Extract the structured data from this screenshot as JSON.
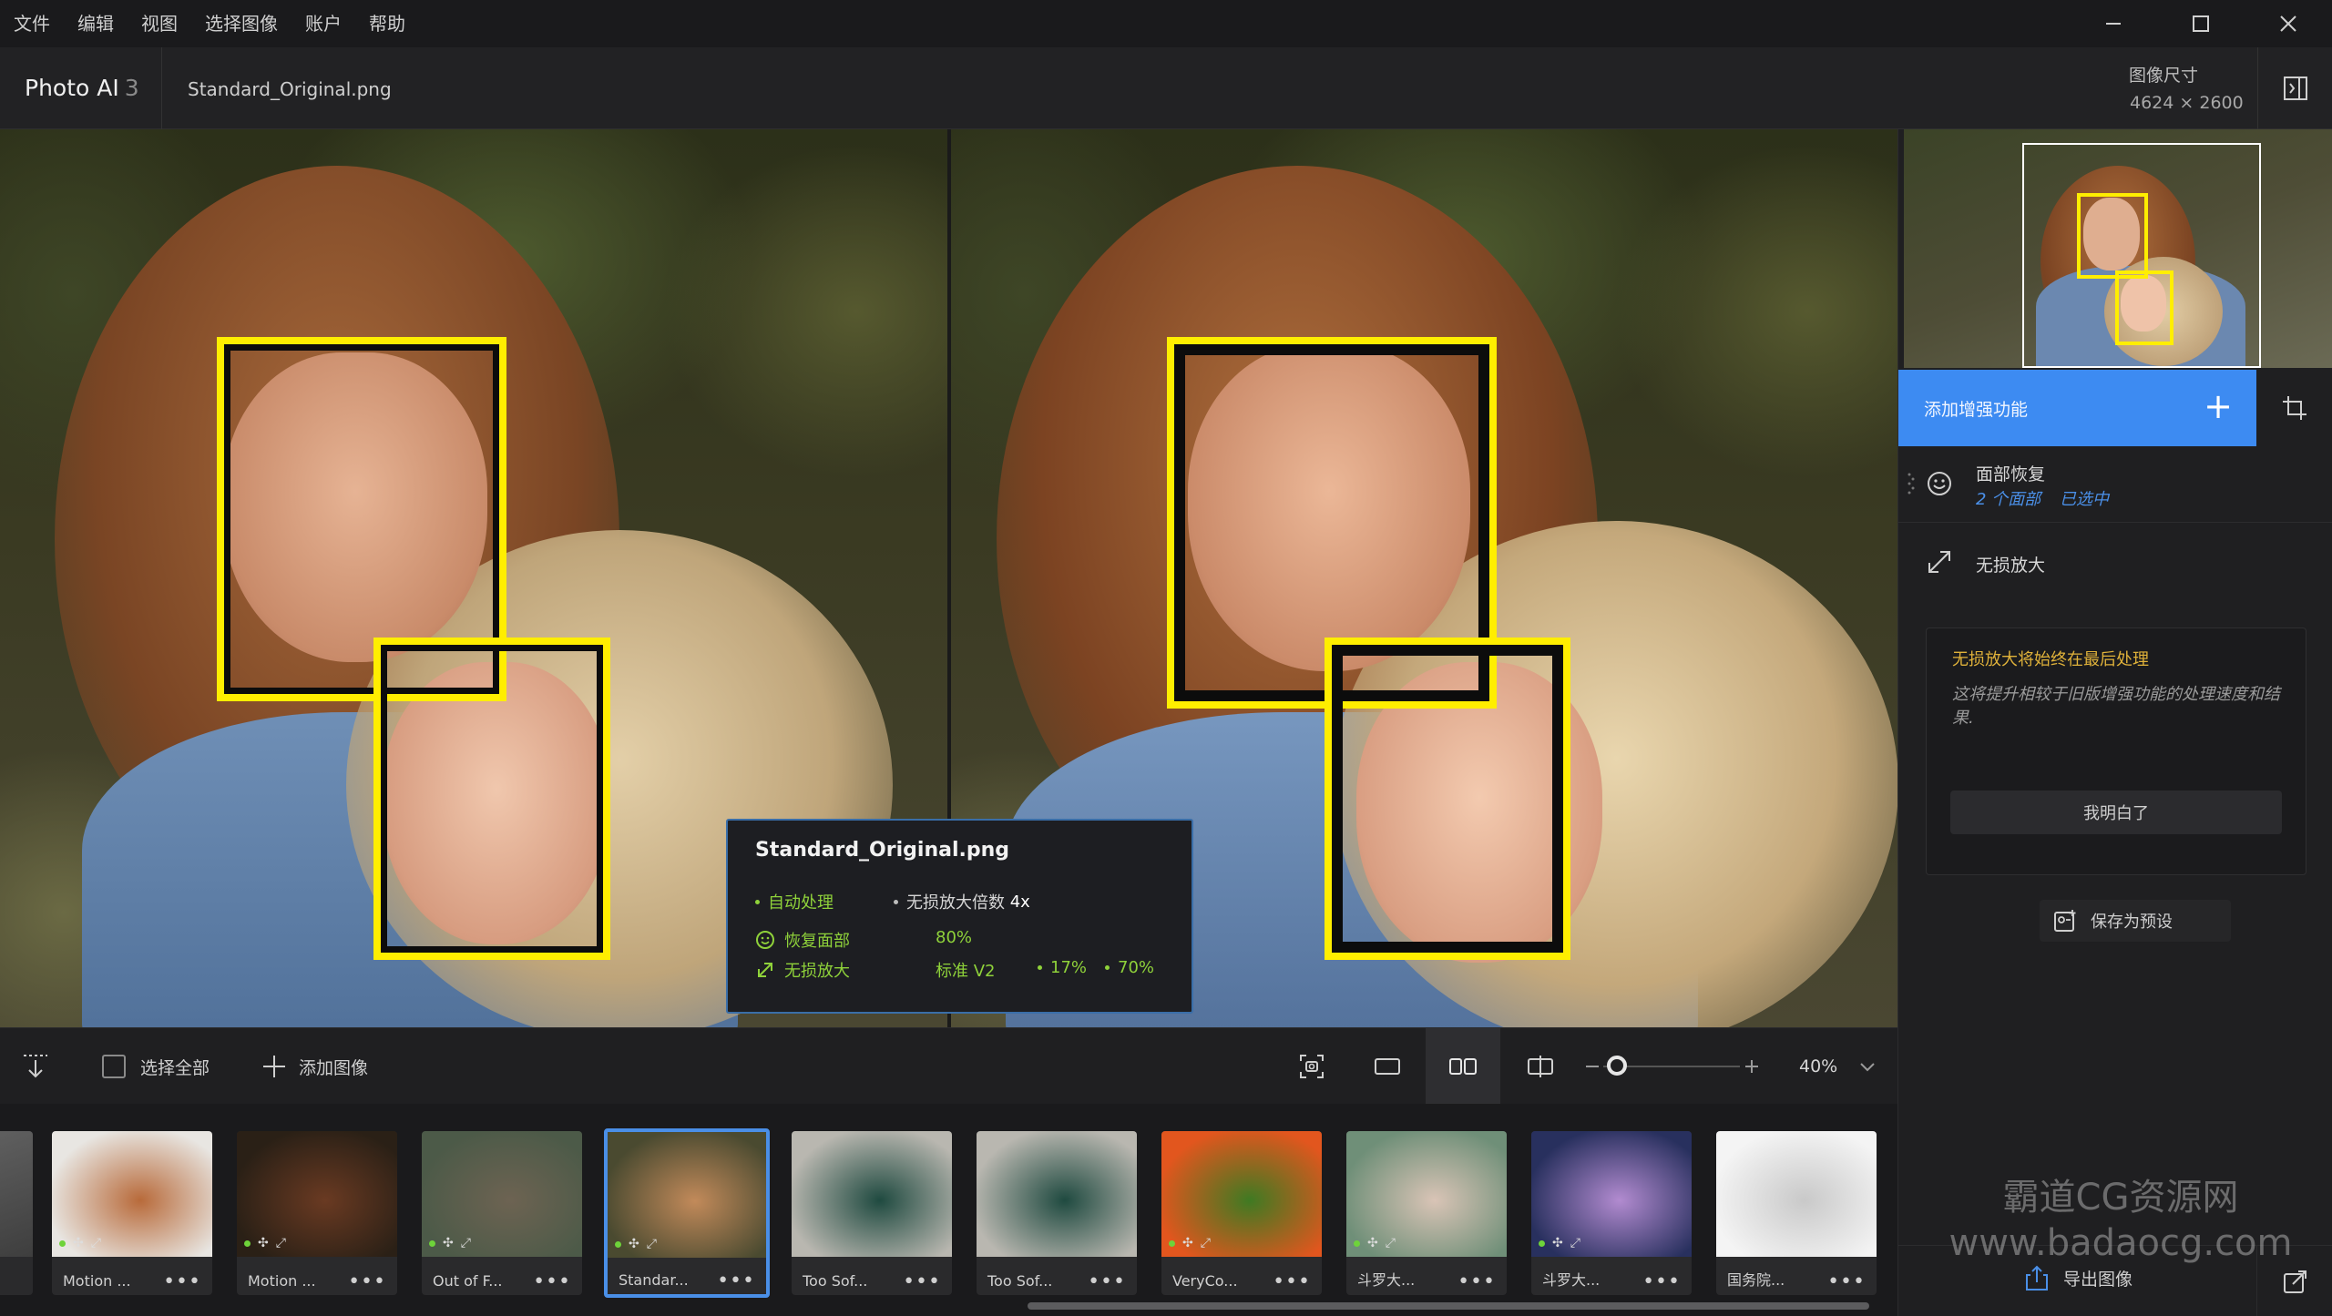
{
  "menu": [
    "文件",
    "编辑",
    "视图",
    "选择图像",
    "账户",
    "帮助"
  ],
  "header": {
    "app_name": "Photo AI",
    "app_version": "3",
    "file_name": "Standard_Original.png",
    "image_size_label": "图像尺寸",
    "image_size_value": "4624 × 2600"
  },
  "info_card": {
    "title": "Standard_Original.png",
    "auto_process": "自动处理",
    "upscale_factor_label": "无损放大倍数",
    "upscale_factor_value": "4x",
    "face_label": "恢复面部",
    "face_value": "80%",
    "upscale_label": "无损放大",
    "upscale_model": "标准 V2",
    "upscale_val1": "17%",
    "upscale_val2": "70%"
  },
  "toolbar": {
    "select_all": "选择全部",
    "add_image": "添加图像",
    "zoom": "40%",
    "zoom_level": 0.1
  },
  "thumbnails": [
    {
      "label": "Motion ...",
      "badges": true,
      "selected": false,
      "color1": "#e8e6e2",
      "color2": "#b86a3a"
    },
    {
      "label": "Motion ...",
      "badges": true,
      "selected": false,
      "color1": "#2a2016",
      "color2": "#6a3a22"
    },
    {
      "label": "Out of F...",
      "badges": true,
      "selected": false,
      "color1": "#4c5a48",
      "color2": "#6d6352"
    },
    {
      "label": "Standar...",
      "badges": true,
      "selected": true,
      "color1": "#4a4a30",
      "color2": "#c28a5a"
    },
    {
      "label": "Too Sof...",
      "badges": false,
      "selected": false,
      "color1": "#b9b7b0",
      "color2": "#1f4a40"
    },
    {
      "label": "Too Sof...",
      "badges": false,
      "selected": false,
      "color1": "#b9b7b0",
      "color2": "#1f4a40"
    },
    {
      "label": "VeryCo...",
      "badges": true,
      "selected": false,
      "color1": "#e2561e",
      "color2": "#3f7a22"
    },
    {
      "label": "斗罗大...",
      "badges": true,
      "selected": false,
      "color1": "#6f8f78",
      "color2": "#d9c4b6"
    },
    {
      "label": "斗罗大...",
      "badges": true,
      "selected": false,
      "color1": "#28305e",
      "color2": "#b28bd0"
    },
    {
      "label": "国务院...",
      "badges": false,
      "selected": false,
      "color1": "#f4f4f4",
      "color2": "#c9c9c9"
    }
  ],
  "right_panel": {
    "add_enhancement": "添加增强功能",
    "face_recovery_title": "面部恢复",
    "face_recovery_count": "2 个面部",
    "face_recovery_selected": "已选中",
    "upscale_title": "无损放大",
    "notice_title": "无损放大将始终在最后处理",
    "notice_body": "这将提升相较于旧版增强功能的处理速度和结果.",
    "notice_button": "我明白了",
    "save_preset": "保存为预设",
    "export": "导出图像"
  },
  "watermark": {
    "line1": "霸道CG资源网",
    "line2": "www.badaocg.com"
  },
  "colors": {
    "accent": "#3d8bf2",
    "detection_box": "#ffee00",
    "status_green": "#8fd23a",
    "warning": "#e0b23a"
  }
}
